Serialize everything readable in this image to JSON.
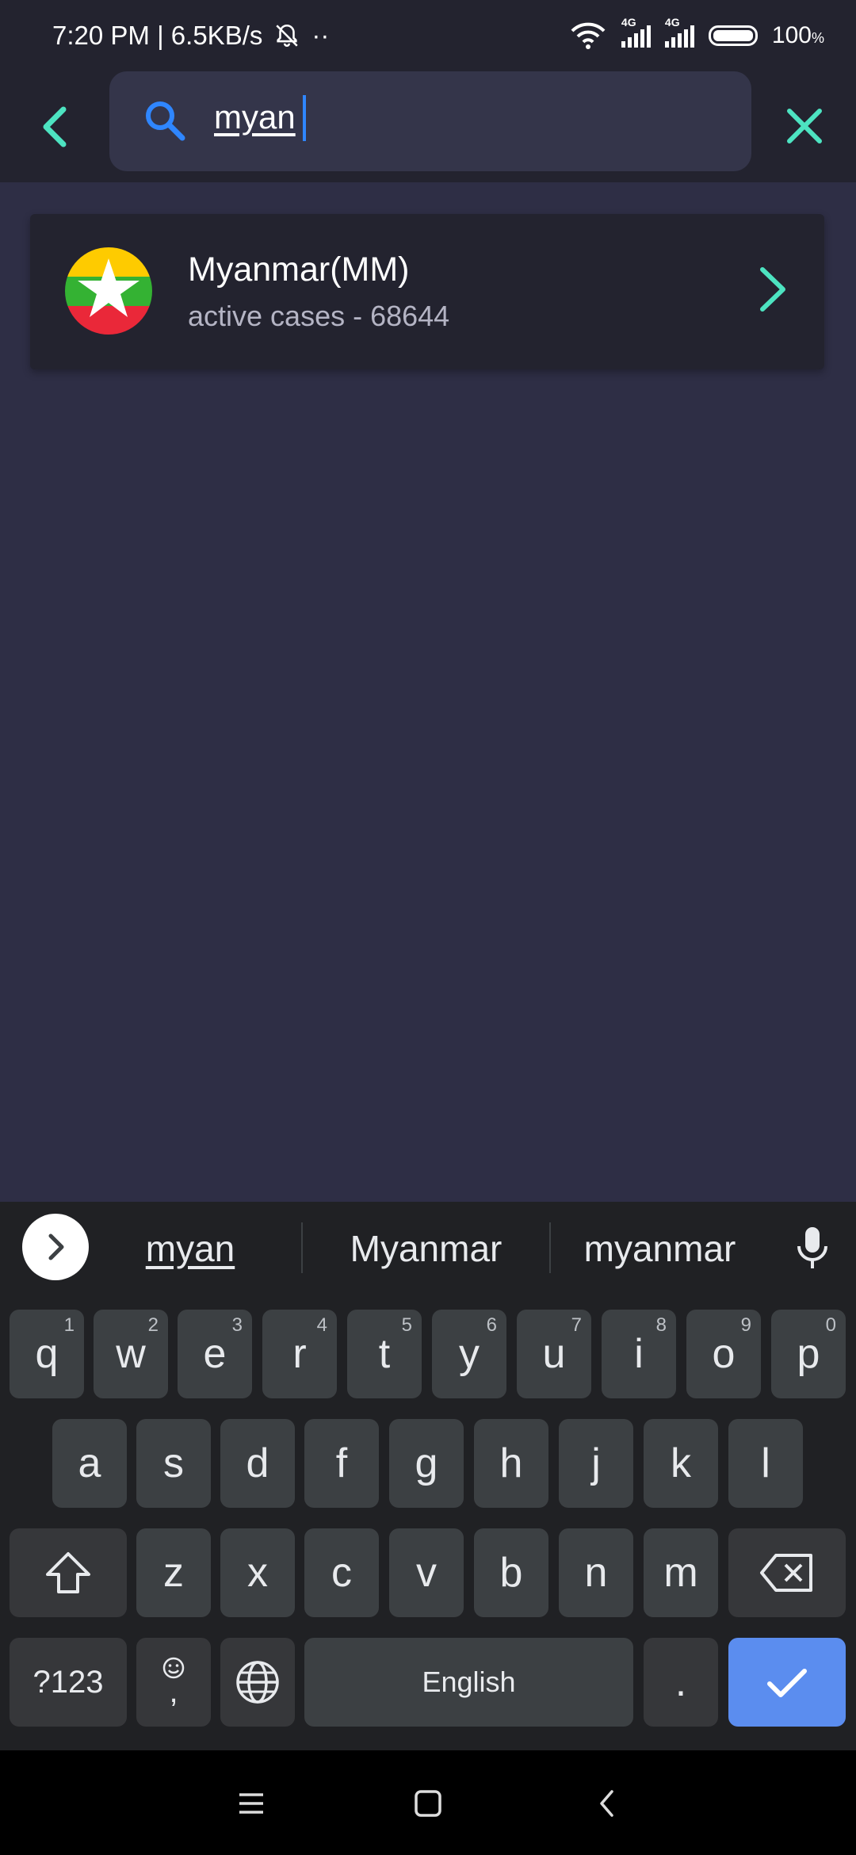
{
  "status_bar": {
    "time_speed": "7:20 PM | 6.5KB/s",
    "dots": "··",
    "net1": "4G",
    "net2": "4G",
    "battery": "100",
    "battery_unit": "%"
  },
  "app_bar": {
    "search_value": "myan"
  },
  "results": [
    {
      "name": "Myanmar(MM)",
      "cases": "active cases - 68644"
    }
  ],
  "keyboard": {
    "suggestions": [
      "myan",
      "Myanmar",
      "myanmar"
    ],
    "row1": [
      {
        "key": "q",
        "hint": "1"
      },
      {
        "key": "w",
        "hint": "2"
      },
      {
        "key": "e",
        "hint": "3"
      },
      {
        "key": "r",
        "hint": "4"
      },
      {
        "key": "t",
        "hint": "5"
      },
      {
        "key": "y",
        "hint": "6"
      },
      {
        "key": "u",
        "hint": "7"
      },
      {
        "key": "i",
        "hint": "8"
      },
      {
        "key": "o",
        "hint": "9"
      },
      {
        "key": "p",
        "hint": "0"
      }
    ],
    "row2": [
      "a",
      "s",
      "d",
      "f",
      "g",
      "h",
      "j",
      "k",
      "l"
    ],
    "row3": [
      "z",
      "x",
      "c",
      "v",
      "b",
      "n",
      "m"
    ],
    "symbols_key": "?123",
    "emoji_comma": ",",
    "space_label": "English",
    "period_key": "."
  },
  "colors": {
    "accent": "#4de3c1",
    "background": "#2e2e45",
    "bar": "#23232f",
    "search_icon": "#2f86ff",
    "enter_key": "#5b8def"
  }
}
